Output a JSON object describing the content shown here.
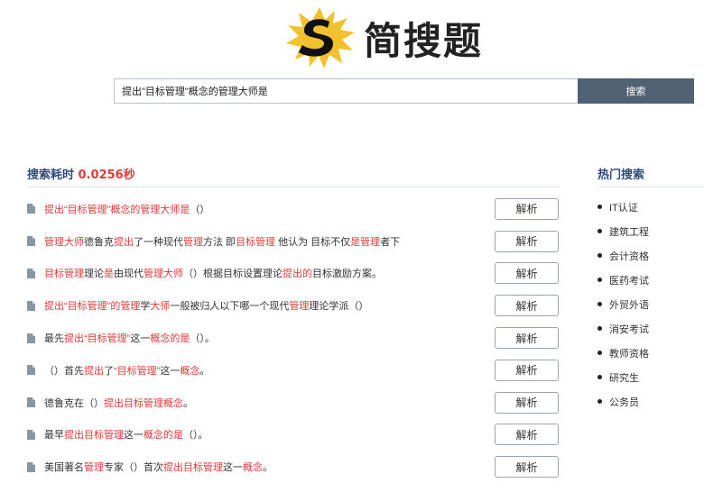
{
  "brand": {
    "name": "简搜题",
    "logo_icon": "splash-s-logo-icon",
    "logo_colors": {
      "splash": "#f2c12e",
      "letter": "#111111"
    }
  },
  "search": {
    "query": "提出\"目标管理\"概念的管理大师是",
    "button_label": "搜索"
  },
  "stats": {
    "label": "搜索耗时",
    "time": "0.0256秒"
  },
  "results": [
    {
      "segments": [
        {
          "t": "提出“目标管理”概念的管理大师是",
          "h": true
        },
        {
          "t": "（）",
          "h": false
        }
      ],
      "action": "解析"
    },
    {
      "segments": [
        {
          "t": "管理大师",
          "h": true
        },
        {
          "t": "德鲁克",
          "h": false
        },
        {
          "t": "提出",
          "h": true
        },
        {
          "t": "了一种现代",
          "h": false
        },
        {
          "t": "管理",
          "h": true
        },
        {
          "t": "方法 即",
          "h": false
        },
        {
          "t": "目标管理",
          "h": true
        },
        {
          "t": " 他认为 目标不仅",
          "h": false
        },
        {
          "t": "是管理",
          "h": true
        },
        {
          "t": "者下",
          "h": false
        }
      ],
      "action": "解析"
    },
    {
      "segments": [
        {
          "t": "目标管理",
          "h": true
        },
        {
          "t": "理论",
          "h": false
        },
        {
          "t": "是",
          "h": true
        },
        {
          "t": "由现代",
          "h": false
        },
        {
          "t": "管理大师",
          "h": true
        },
        {
          "t": "（）根据目标设置理论",
          "h": false
        },
        {
          "t": "提出的",
          "h": true
        },
        {
          "t": "目标激励方案。",
          "h": false
        }
      ],
      "action": "解析"
    },
    {
      "segments": [
        {
          "t": "提出“目标管理”的管理",
          "h": true
        },
        {
          "t": "学",
          "h": false
        },
        {
          "t": "大师",
          "h": true
        },
        {
          "t": "一般被归人以下哪一个现代",
          "h": false
        },
        {
          "t": "管理",
          "h": true
        },
        {
          "t": "理论学派（）",
          "h": false
        }
      ],
      "action": "解析"
    },
    {
      "segments": [
        {
          "t": "最先",
          "h": false
        },
        {
          "t": "提出“目标管理”",
          "h": true
        },
        {
          "t": "这一",
          "h": false
        },
        {
          "t": "概念的是",
          "h": true
        },
        {
          "t": "（）。",
          "h": false
        }
      ],
      "action": "解析"
    },
    {
      "segments": [
        {
          "t": "（）首先",
          "h": false
        },
        {
          "t": "提出",
          "h": true
        },
        {
          "t": "了",
          "h": false
        },
        {
          "t": "“目标管理”",
          "h": true
        },
        {
          "t": "这一",
          "h": false
        },
        {
          "t": "概念",
          "h": true
        },
        {
          "t": "。",
          "h": false
        }
      ],
      "action": "解析"
    },
    {
      "segments": [
        {
          "t": "德鲁克在（）",
          "h": false
        },
        {
          "t": "提出目标管理概念",
          "h": true
        },
        {
          "t": "。",
          "h": false
        }
      ],
      "action": "解析"
    },
    {
      "segments": [
        {
          "t": "最早",
          "h": false
        },
        {
          "t": "提出目标管理",
          "h": true
        },
        {
          "t": "这一",
          "h": false
        },
        {
          "t": "概念的是",
          "h": true
        },
        {
          "t": "（）。",
          "h": false
        }
      ],
      "action": "解析"
    },
    {
      "segments": [
        {
          "t": "美国著名",
          "h": false
        },
        {
          "t": "管理",
          "h": true
        },
        {
          "t": "专家（）首次",
          "h": false
        },
        {
          "t": "提出目标管理",
          "h": true
        },
        {
          "t": "这一",
          "h": false
        },
        {
          "t": "概念",
          "h": true
        },
        {
          "t": "。",
          "h": false
        }
      ],
      "action": "解析"
    }
  ],
  "hot_search": {
    "title": "热门搜索",
    "items": [
      "IT认证",
      "建筑工程",
      "会计资格",
      "医药考试",
      "外贸外语",
      "消安考试",
      "教师资格",
      "研究生",
      "公务员"
    ]
  },
  "colors": {
    "highlight": "#e03a3a",
    "heading": "#2d4a7a",
    "search_button": "#4f6172"
  },
  "icons": {
    "result": "document-icon",
    "hot_item": "bullet-icon"
  }
}
